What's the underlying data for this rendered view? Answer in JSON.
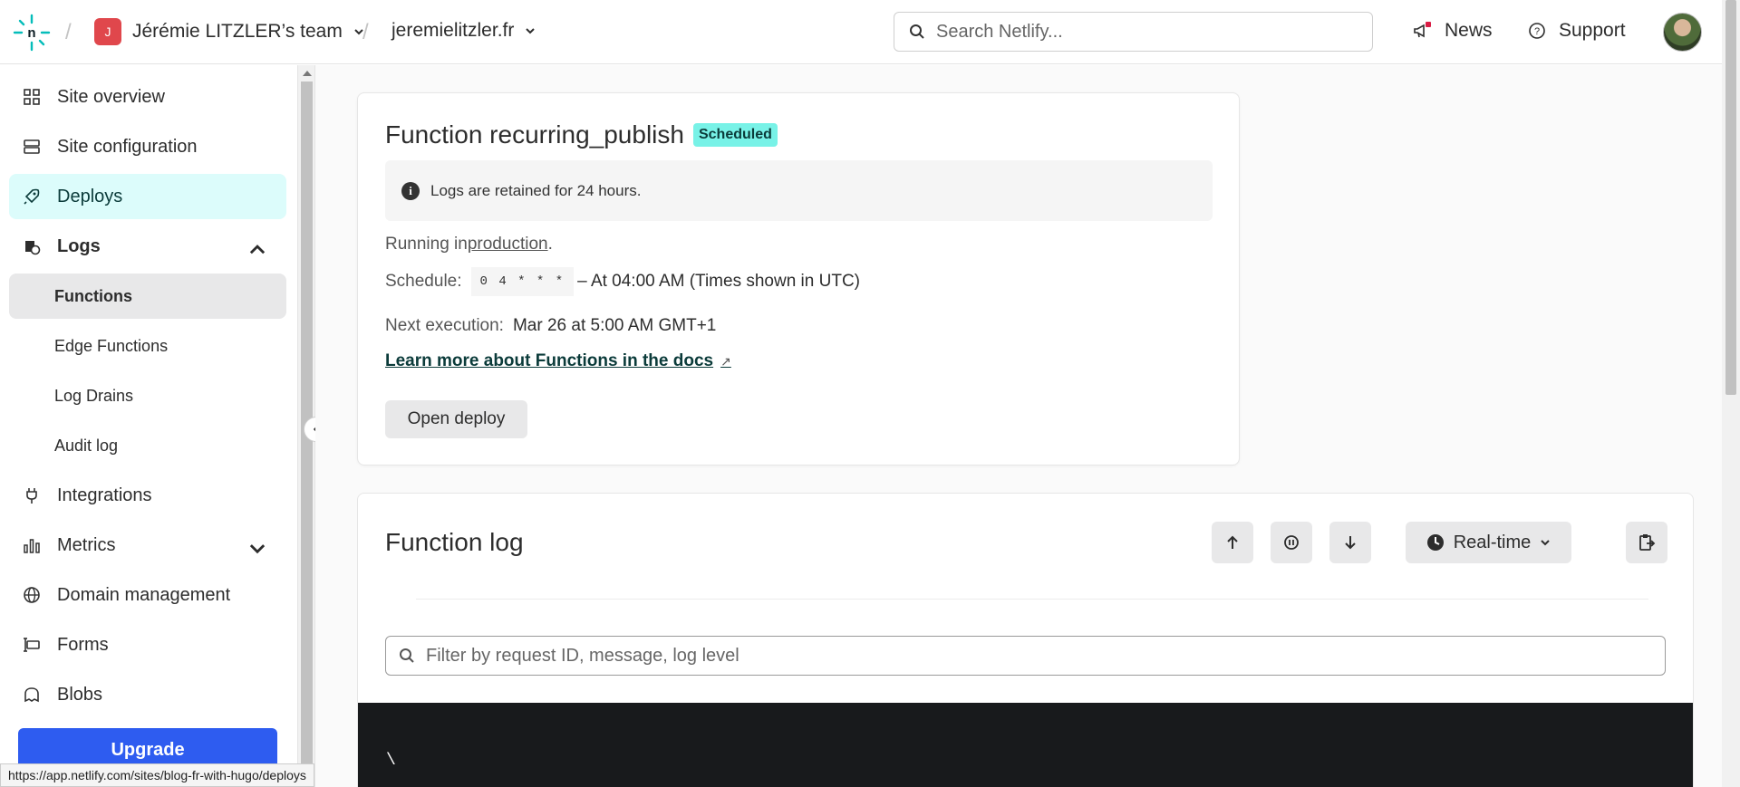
{
  "header": {
    "team_initial": "J",
    "team_name": "Jérémie LITZLER’s team",
    "site_name": "jeremielitzler.fr",
    "search_placeholder": "Search Netlify...",
    "news_label": "News",
    "support_label": "Support"
  },
  "sidebar": {
    "items": [
      {
        "label": "Site overview",
        "icon": "grid-icon"
      },
      {
        "label": "Site configuration",
        "icon": "config-icon"
      },
      {
        "label": "Deploys",
        "icon": "rocket-icon"
      },
      {
        "label": "Logs",
        "icon": "logs-icon"
      },
      {
        "label": "Functions"
      },
      {
        "label": "Edge Functions"
      },
      {
        "label": "Log Drains"
      },
      {
        "label": "Audit log"
      },
      {
        "label": "Integrations",
        "icon": "plug-icon"
      },
      {
        "label": "Metrics",
        "icon": "metrics-icon"
      },
      {
        "label": "Domain management",
        "icon": "globe-icon"
      },
      {
        "label": "Forms",
        "icon": "forms-icon"
      },
      {
        "label": "Blobs",
        "icon": "blob-icon"
      }
    ],
    "upgrade_label": "Upgrade"
  },
  "status_url": "https://app.netlify.com/sites/blog-fr-with-hugo/deploys",
  "function_card": {
    "title": "Function recurring_publish",
    "badge": "Scheduled",
    "info": "Logs are retained for 24 hours.",
    "running_prefix": "Running in ",
    "running_link": "production",
    "running_suffix": ".",
    "schedule_label": "Schedule:",
    "schedule_cron": "0 4 * * *",
    "schedule_desc": "– At 04:00 AM (Times shown in UTC)",
    "next_label": "Next execution:",
    "next_value": "Mar 26 at 5:00 AM GMT+1",
    "docs_link": "Learn more about Functions in the docs",
    "docs_ext": "↗",
    "open_deploy": "Open deploy"
  },
  "log_card": {
    "title": "Function log",
    "realtime_label": "Real-time",
    "filter_placeholder": "Filter by request ID, message, log level",
    "terminal_text": "\\"
  },
  "colors": {
    "accent_teal": "#05bdba",
    "active_bg": "#dcfcfb",
    "badge_bg": "#78f2e7",
    "upgrade_blue": "#2e5cf0",
    "terminal_bg": "#181a1c"
  }
}
